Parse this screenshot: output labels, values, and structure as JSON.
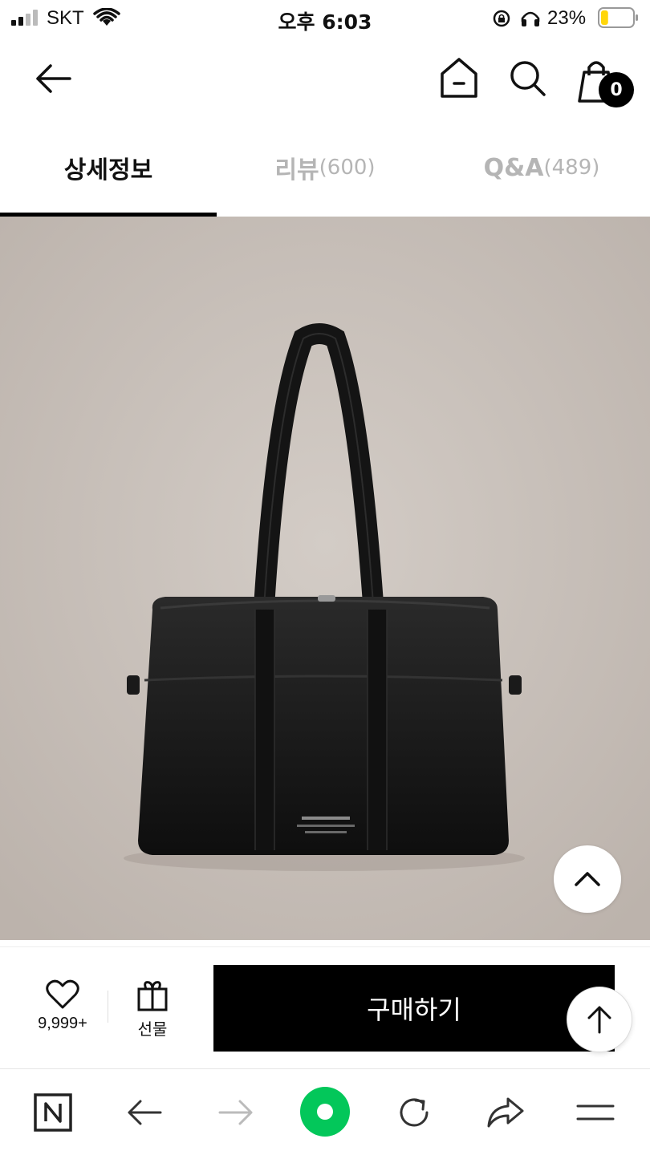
{
  "status_bar": {
    "carrier": "SKT",
    "time": "오후 6:03",
    "battery_percent": "23%",
    "battery_level": 0.23
  },
  "header": {
    "cart_count": "0",
    "icons": [
      "back-arrow-icon",
      "home-icon",
      "search-icon",
      "cart-icon"
    ]
  },
  "tabs": [
    {
      "label": "상세정보",
      "count": ""
    },
    {
      "label": "리뷰",
      "count": "(600)"
    },
    {
      "label": "Q&A",
      "count": "(489)"
    }
  ],
  "product": {
    "image_description_icon": "black-shoulder-bag"
  },
  "actions": {
    "like_count": "9,999+",
    "gift_label": "선물",
    "buy_label": "구매하기"
  },
  "browser_toolbar": {
    "icons": [
      "naver-n-icon",
      "browser-back-icon",
      "browser-forward-icon",
      "green-home-dot-icon",
      "reload-icon",
      "share-icon",
      "menu-icon"
    ]
  },
  "colors": {
    "accent_green": "#03c75a",
    "buy_button": "#000000",
    "image_background": "#c7bfb9",
    "battery_fill": "#ffd60a"
  }
}
